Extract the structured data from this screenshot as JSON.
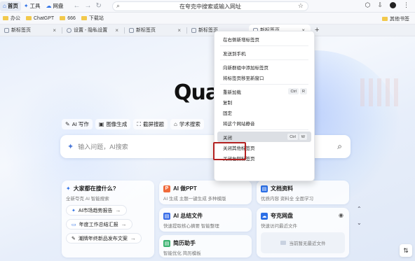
{
  "topbar": {
    "nav": [
      {
        "label": "首页",
        "icon": "home-icon",
        "active": true
      },
      {
        "label": "工具",
        "icon": "tools-icon",
        "active": false
      },
      {
        "label": "网盘",
        "icon": "cloud-icon",
        "active": false
      }
    ],
    "address": "在夸克中搜索或输入网址"
  },
  "bookmarks": {
    "items": [
      "办公",
      "ChatGPT",
      "666",
      "下载站"
    ],
    "right": "其他书签"
  },
  "tabs": [
    {
      "label": "新标签页"
    },
    {
      "label": "设置 - 隐私设置"
    },
    {
      "label": "新标签页"
    },
    {
      "label": "新标签页"
    },
    {
      "label": "新标签页"
    }
  ],
  "main": {
    "logo": "Qua",
    "chips": [
      {
        "label": "AI 写作",
        "icon": "pen-icon"
      },
      {
        "label": "图像生成",
        "icon": "image-icon"
      },
      {
        "label": "截屏搜题",
        "icon": "screenshot-icon"
      },
      {
        "label": "学术搜索",
        "icon": "graduation-icon"
      }
    ],
    "search_placeholder": "输入问题，AI搜索",
    "card_trend": {
      "title": "大家都在搜什么?",
      "sub": "全新夸克 AI 智能搜索",
      "pills": [
        "AI市场趋势报告",
        "年度工作总结汇报",
        "潮牌年终新品发布文案"
      ]
    },
    "card_ppt": {
      "title": "AI 做PPT",
      "sub": "AI 生成 主题一键生成 多种模版"
    },
    "card_doc": {
      "title": "文档资料",
      "sub": "优质内容 资料全 全面学习"
    },
    "card_summary": {
      "title": "AI 总结文件",
      "sub": "快速提取核心摘要 智能整理"
    },
    "card_resume": {
      "title": "简历助手",
      "sub": "智能优化 简历模板"
    },
    "card_cloud": {
      "title": "夸克网盘",
      "sub": "快速访问最近文件",
      "empty": "当前暂无最近文件"
    }
  },
  "context_menu": {
    "items": [
      {
        "label": "在右侧新增标签页"
      },
      {
        "sep": true
      },
      {
        "label": "发送到手机"
      },
      {
        "sep": true
      },
      {
        "label": "向新群组中添加标签页"
      },
      {
        "label": "将标签页移至新窗口"
      },
      {
        "sep": true
      },
      {
        "label": "重新加载",
        "keys": [
          "Ctrl",
          "R"
        ]
      },
      {
        "label": "复制"
      },
      {
        "label": "固定"
      },
      {
        "label": "将这个网站静音"
      },
      {
        "sep": true
      },
      {
        "label": "关闭",
        "keys": [
          "Ctrl",
          "W"
        ],
        "highlight": true
      },
      {
        "label": "关闭其他标签页"
      },
      {
        "label": "关闭右侧标签页"
      }
    ]
  },
  "colors": {
    "accent": "#2b6fe6",
    "highlight_border": "#b32121"
  }
}
